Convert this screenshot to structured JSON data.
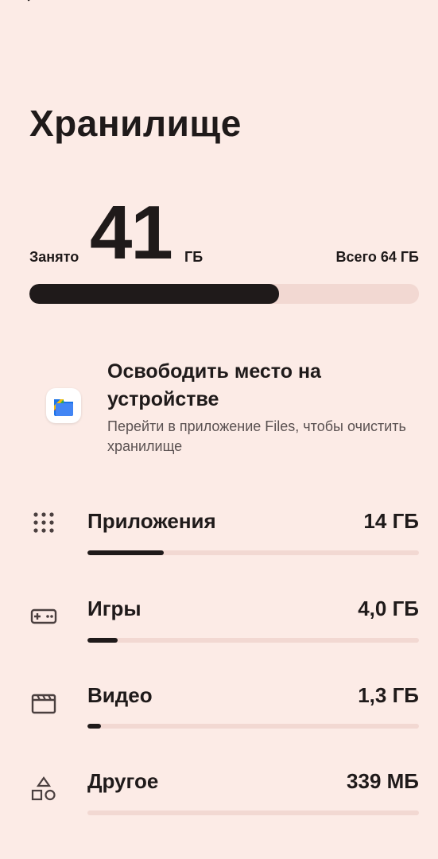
{
  "header": {
    "back_icon": "arrow-left-icon",
    "title": "Хранилище"
  },
  "summary": {
    "used_label": "Занято",
    "used_value": "41",
    "used_unit": "ГБ",
    "total_label": "Всего 64 ГБ",
    "used_fraction": 0.64
  },
  "free_up": {
    "icon": "files-app-icon",
    "title": "Освободить место на устройстве",
    "subtitle": "Перейти в приложение Files, чтобы очистить хранилище"
  },
  "categories": [
    {
      "icon": "apps-grid-icon",
      "label": "Приложения",
      "value": "14 ГБ",
      "fraction": 0.23
    },
    {
      "icon": "gamepad-icon",
      "label": "Игры",
      "value": "4,0 ГБ",
      "fraction": 0.09
    },
    {
      "icon": "video-clapper-icon",
      "label": "Видео",
      "value": "1,3 ГБ",
      "fraction": 0.04
    },
    {
      "icon": "shapes-icon",
      "label": "Другое",
      "value": "339 МБ",
      "fraction": 0.0
    }
  ],
  "colors": {
    "background": "#fcebe6",
    "bar_fill": "#1f1a1a",
    "bar_track": "#f2d8d2"
  }
}
